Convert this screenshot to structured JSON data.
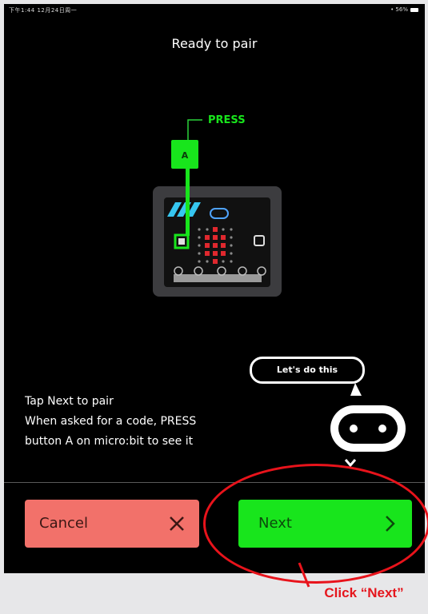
{
  "status_bar": {
    "left_text": "下午1:44 12月24日周一",
    "right_text": "• 56%"
  },
  "title": "Ready to pair",
  "illustration": {
    "press_label": "PRESS",
    "button_label": "A",
    "accent_color": "#18e51c",
    "led_color": "#e0282e"
  },
  "bubble": {
    "text": "Let's do this"
  },
  "instructions": {
    "line1": "Tap Next to pair",
    "line2": "When asked for a code, PRESS",
    "line3": "button A on micro:bit to see it"
  },
  "buttons": {
    "cancel": {
      "label": "Cancel",
      "icon": "close-icon",
      "color": "#f2716a"
    },
    "next": {
      "label": "Next",
      "icon": "chevron-right-icon",
      "color": "#18e51c"
    }
  },
  "callout": {
    "text": "Click “Next”",
    "color": "#e5161d"
  }
}
